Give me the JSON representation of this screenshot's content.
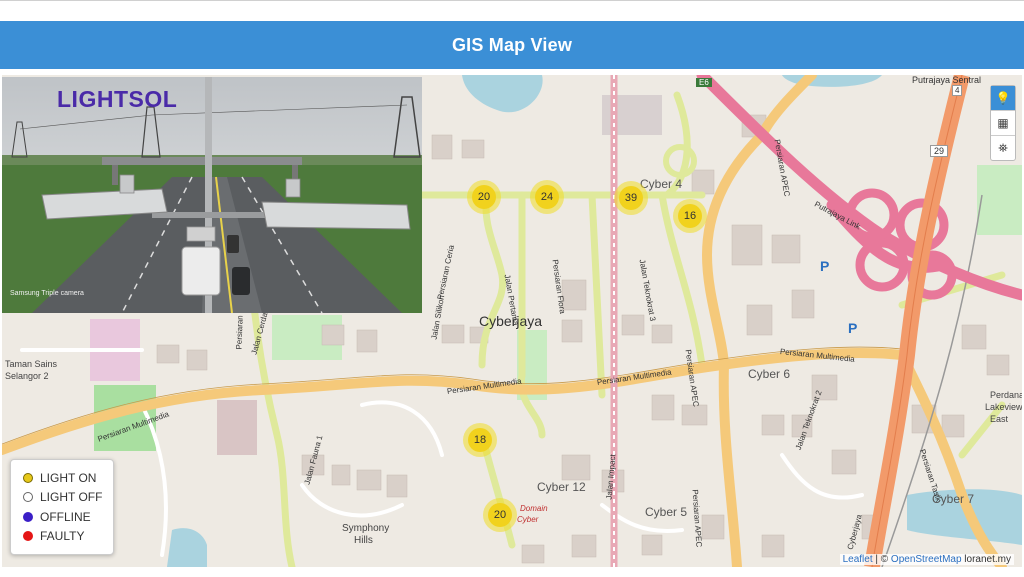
{
  "header": {
    "title": "GIS Map View"
  },
  "photo": {
    "brand": "LIGHTSOL",
    "watermark": "Samsung Triple camera"
  },
  "map": {
    "place_labels": [
      {
        "text": "Cyberjaya"
      },
      {
        "text": "Cyber 4"
      },
      {
        "text": "Cyber 6"
      },
      {
        "text": "Cyber 12"
      },
      {
        "text": "Cyber 5"
      },
      {
        "text": "Cyber 7"
      },
      {
        "text": "Taman Sains"
      },
      {
        "text": "Selangor 2"
      },
      {
        "text": "Symphony"
      },
      {
        "text": "Hills"
      },
      {
        "text": "Perdana"
      },
      {
        "text": "Lakeview"
      },
      {
        "text": "East"
      },
      {
        "text": "Putrajaya Sentral"
      },
      {
        "text": "Domain"
      },
      {
        "text": "Cyber"
      }
    ],
    "road_labels": [
      {
        "text": "Persiaran Multimedia"
      },
      {
        "text": "Persiaran Multimedia"
      },
      {
        "text": "Persiaran Multimedia"
      },
      {
        "text": "Persiaran Multimedia"
      },
      {
        "text": "Persiaran Flora"
      },
      {
        "text": "Persiaran APEC"
      },
      {
        "text": "Persiaran APEC"
      },
      {
        "text": "Persiaran APEC"
      },
      {
        "text": "Putrajaya Link"
      },
      {
        "text": "Persiaran Ceria"
      },
      {
        "text": "Jalan Teknokrat 3"
      },
      {
        "text": "Persiaran Tasik"
      },
      {
        "text": "Cyberjaya"
      },
      {
        "text": "Jalan Pertama"
      },
      {
        "text": "Jalan Silikon"
      },
      {
        "text": "Persiaran Bestari"
      },
      {
        "text": "Jalan Cerdas"
      },
      {
        "text": "Jalan Impact"
      },
      {
        "text": "Jalan Teknokrat 2"
      },
      {
        "text": "Jalan Fauna 1"
      }
    ],
    "shields": [
      "E6",
      "29",
      "4"
    ],
    "parking": [
      "P",
      "P"
    ]
  },
  "clusters": [
    {
      "count": "20"
    },
    {
      "count": "24"
    },
    {
      "count": "39"
    },
    {
      "count": "16"
    },
    {
      "count": "18"
    },
    {
      "count": "20"
    }
  ],
  "controls": [
    {
      "icon": "bulb-icon",
      "glyph": "💡"
    },
    {
      "icon": "building-icon",
      "glyph": "▦"
    },
    {
      "icon": "satellite-icon",
      "glyph": "⛯"
    }
  ],
  "legend": {
    "items": [
      {
        "label": "LIGHT ON",
        "color": "#e6c81a",
        "border": "#7a6a00"
      },
      {
        "label": "LIGHT OFF",
        "color": "#ffffff",
        "border": "#666666"
      },
      {
        "label": "OFFLINE",
        "color": "#3b1fc7",
        "border": "#3b1fc7"
      },
      {
        "label": "FAULTY",
        "color": "#e51616",
        "border": "#e51616"
      }
    ]
  },
  "attribution": {
    "leaflet": "Leaflet",
    "sep": " | © ",
    "osm": "OpenStreetMap",
    "extra": " loranet.my"
  },
  "colors": {
    "header": "#3b8fd6",
    "major_road": "#f5c97a",
    "minor_road": "#e8f0a0",
    "highway": "#e8789a",
    "motorway": "#f29a6a",
    "water": "#aad3df",
    "park": "#c9ecc2"
  }
}
